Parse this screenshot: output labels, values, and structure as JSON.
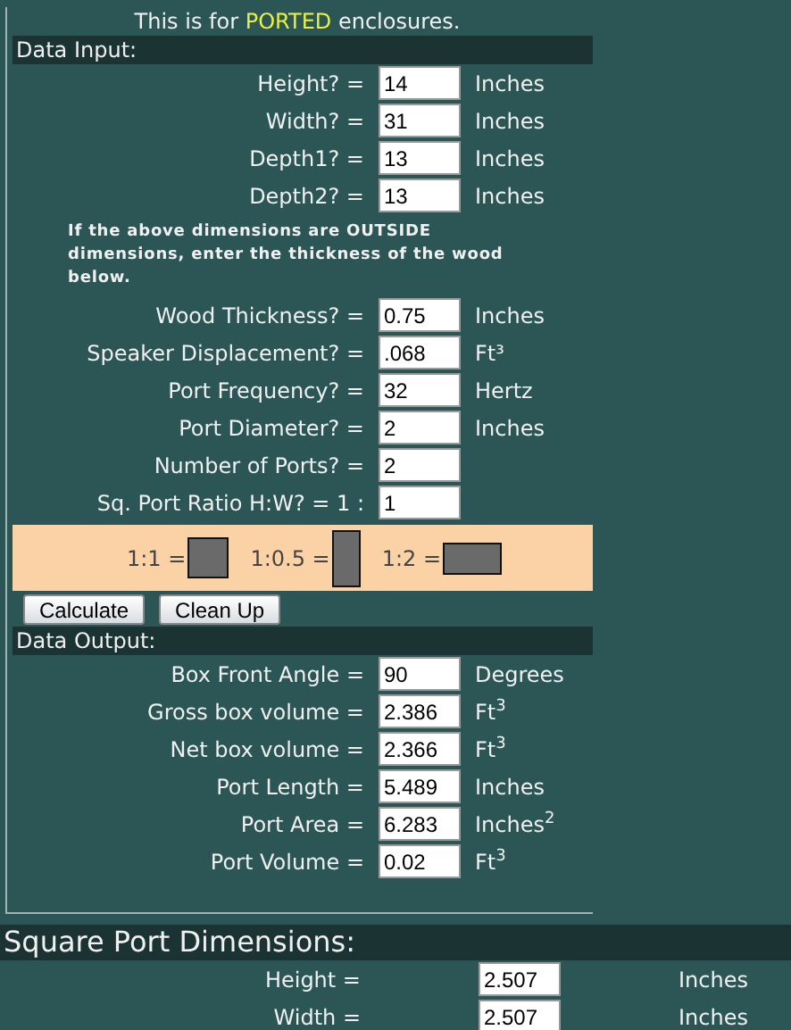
{
  "intro": {
    "before": "This is for",
    "highlight": "PORTED",
    "after": "enclosures."
  },
  "input_section": {
    "title": "Data Input:",
    "rows": [
      {
        "label": "Height? =",
        "value": "14",
        "unit": "Inches"
      },
      {
        "label": "Width? =",
        "value": "31",
        "unit": "Inches"
      },
      {
        "label": "Depth1? =",
        "value": "13",
        "unit": "Inches"
      },
      {
        "label": "Depth2? =",
        "value": "13",
        "unit": "Inches"
      }
    ],
    "note": "If the above dimensions are OUTSIDE dimensions, enter the thickness of the wood below.",
    "rows2": [
      {
        "label": "Wood Thickness? =",
        "value": "0.75",
        "unit": "Inches"
      },
      {
        "label": "Speaker Displacement? =",
        "value": ".068",
        "unit": "Ft³"
      },
      {
        "label": "Port Frequency? =",
        "value": "32",
        "unit": "Hertz"
      },
      {
        "label": "Port Diameter? =",
        "value": "2",
        "unit": "Inches"
      },
      {
        "label": "Number of Ports? =",
        "value": "2"
      },
      {
        "label": "Sq. Port Ratio H:W? = 1 :",
        "value": "1"
      }
    ],
    "ratios": [
      {
        "label": "1:1 =",
        "kind": "square"
      },
      {
        "label": "1:0.5 =",
        "kind": "tall"
      },
      {
        "label": "1:2 =",
        "kind": "wide"
      }
    ]
  },
  "buttons": [
    "Calculate",
    "Clean Up"
  ],
  "output_section": {
    "title": "Data Output:",
    "rows": [
      {
        "label": "Box Front Angle =",
        "value": "90",
        "unit": "Degrees"
      },
      {
        "label": "Gross box volume =",
        "value": "2.386",
        "unit": "Ft$^{3}$"
      },
      {
        "label": "Net box volume =",
        "value": "2.366",
        "unit": "Ft$^{3}$"
      },
      {
        "label": "Port Length =",
        "value": "5.489",
        "unit": "Inches"
      },
      {
        "label": "Port Area =",
        "value": "6.283",
        "unit": "Inches$^{2}$"
      },
      {
        "label": "Port Volume =",
        "value": "0.02",
        "unit": "Ft$^{3}$"
      }
    ]
  },
  "square_port": {
    "title": "Square Port Dimensions:",
    "rows": [
      {
        "label": "Height =",
        "value": "2.507",
        "unit": "Inches"
      },
      {
        "label": "Width =",
        "value": "2.507",
        "unit": "Inches"
      }
    ]
  }
}
